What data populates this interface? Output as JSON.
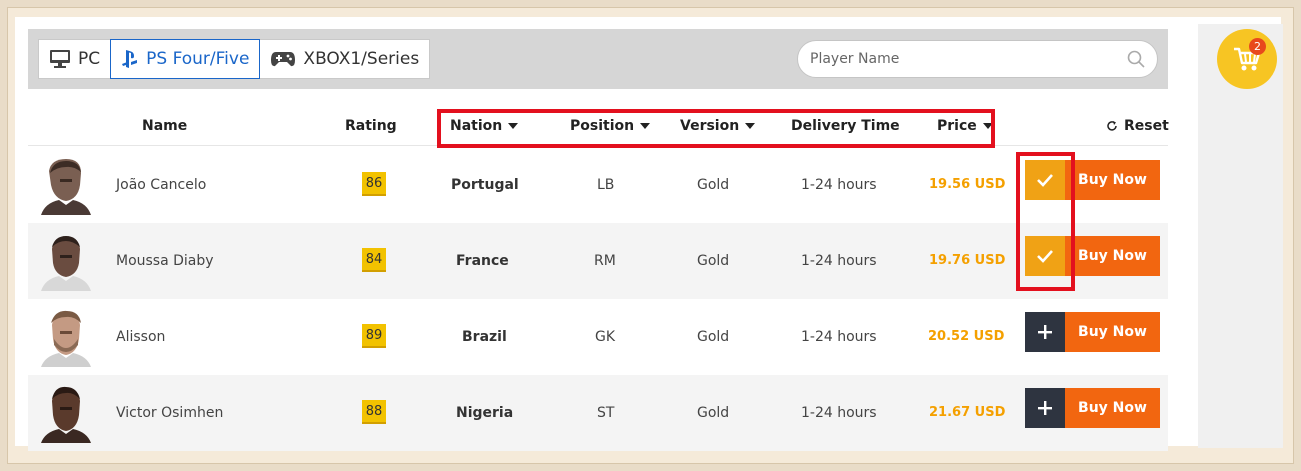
{
  "platforms": [
    {
      "label": "PC",
      "icon": "monitor-icon",
      "active": false
    },
    {
      "label": "PS Four/Five",
      "icon": "playstation-icon",
      "active": true
    },
    {
      "label": "XBOX1/Series",
      "icon": "gamepad-icon",
      "active": false
    }
  ],
  "search": {
    "placeholder": "Player Name",
    "value": ""
  },
  "cart": {
    "count": "2"
  },
  "headers": {
    "name": "Name",
    "rating": "Rating",
    "nation": "Nation",
    "position": "Position",
    "version": "Version",
    "delivery": "Delivery Time",
    "price": "Price",
    "reset": "Reset"
  },
  "players": [
    {
      "name": "João Cancelo",
      "rating": "86",
      "nation": "Portugal",
      "position": "LB",
      "version": "Gold",
      "delivery": "1-24 hours",
      "price": "19.56 USD",
      "selected": true,
      "buy_label": "Buy Now"
    },
    {
      "name": "Moussa Diaby",
      "rating": "84",
      "nation": "France",
      "position": "RM",
      "version": "Gold",
      "delivery": "1-24 hours",
      "price": "19.76 USD",
      "selected": true,
      "buy_label": "Buy Now"
    },
    {
      "name": "Alisson",
      "rating": "89",
      "nation": "Brazil",
      "position": "GK",
      "version": "Gold",
      "delivery": "1-24 hours",
      "price": "20.52 USD",
      "selected": false,
      "buy_label": "Buy Now"
    },
    {
      "name": "Victor Osimhen",
      "rating": "88",
      "nation": "Nigeria",
      "position": "ST",
      "version": "Gold",
      "delivery": "1-24 hours",
      "price": "21.67 USD",
      "selected": false,
      "buy_label": "Buy Now"
    }
  ],
  "colors": {
    "accent": "#f0a215",
    "buy": "#f26610",
    "highlight_box": "#e3101e",
    "active_platform": "#1a66c9"
  }
}
